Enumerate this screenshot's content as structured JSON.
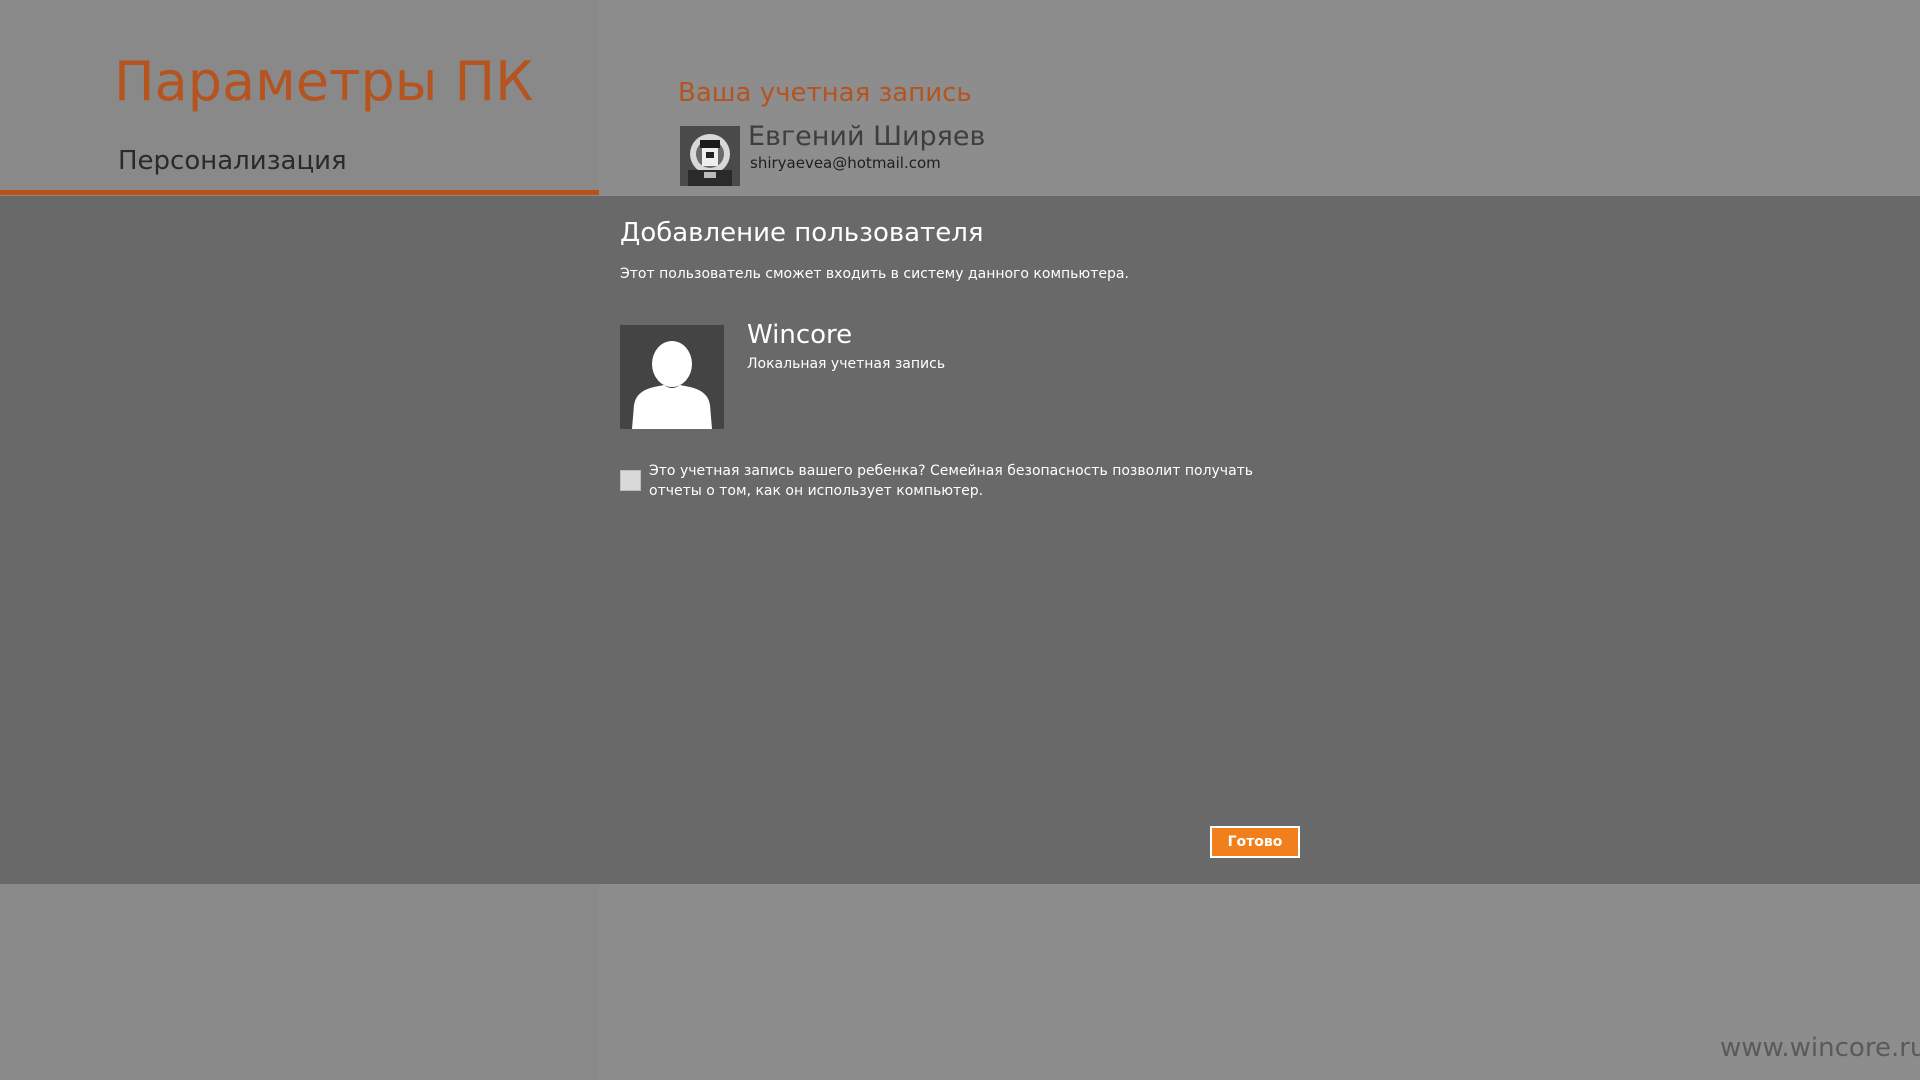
{
  "app": {
    "title": "Параметры ПК"
  },
  "nav": {
    "selected_label": "Персонализация"
  },
  "account": {
    "section_title": "Ваша учетная запись",
    "name": "Евгений Ширяев",
    "email": "shiryaevea@hotmail.com"
  },
  "dialog": {
    "title": "Добавление пользователя",
    "subtitle": "Этот пользователь сможет входить в систему данного компьютера.",
    "user": {
      "name": "Wincore",
      "type": "Локальная учетная запись"
    },
    "child_account": {
      "checked": false,
      "label": "Это учетная запись вашего ребенка? Семейная безопасность позволит получать отчеты о том, как он использует компьютер."
    },
    "done_label": "Готово"
  },
  "watermark": "www.wincore.ru",
  "colors": {
    "accent": "#b5541e",
    "button": "#f07f1c",
    "dialog_bg": "#696969",
    "page_bg": "#8a8a8a"
  }
}
